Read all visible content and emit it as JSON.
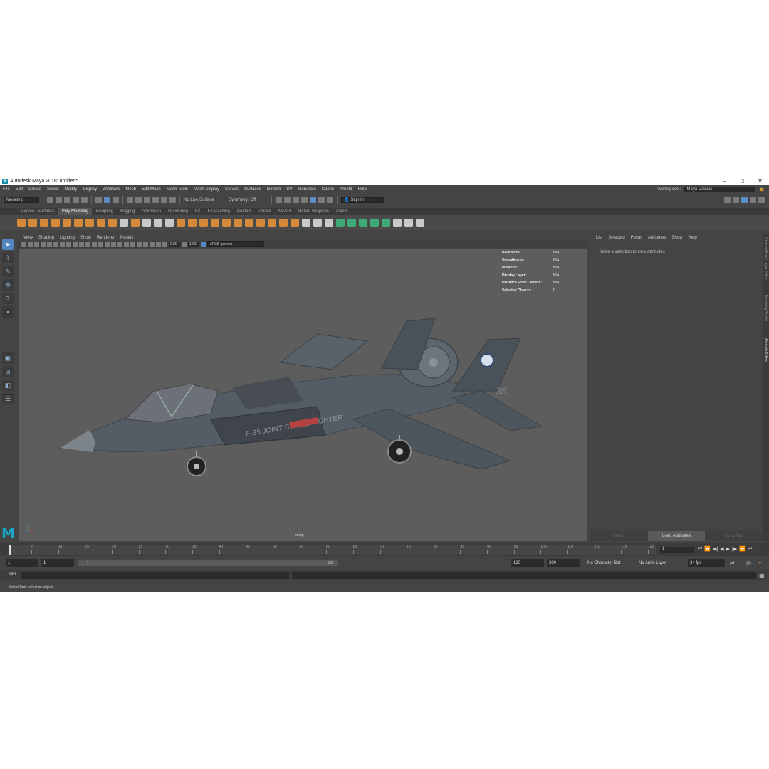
{
  "window": {
    "title": "Autodesk Maya 2018: untitled*",
    "logo": "M",
    "minimize": "–",
    "maximize": "□",
    "close": "✕"
  },
  "menubar": {
    "items": [
      "File",
      "Edit",
      "Create",
      "Select",
      "Modify",
      "Display",
      "Windows",
      "Mesh",
      "Edit Mesh",
      "Mesh Tools",
      "Mesh Display",
      "Curves",
      "Surfaces",
      "Deform",
      "UV",
      "Generate",
      "Cache",
      "Arnold",
      "Help"
    ],
    "workspace_label": "Workspace :",
    "workspace_value": "Maya Classic"
  },
  "statusline": {
    "mode": "Modeling",
    "live_surface": "No Live Surface",
    "symmetry": "Symmetry: Off",
    "sign_in": "Sign In"
  },
  "shelf": {
    "tabs": [
      "Curves / Surfaces",
      "Poly Modeling",
      "Sculpting",
      "Rigging",
      "Animation",
      "Rendering",
      "FX",
      "FX Caching",
      "Custom",
      "Arnold",
      "MASH",
      "Motion Graphics",
      "XGen"
    ],
    "active_tab": "Poly Modeling"
  },
  "viewport": {
    "menu": [
      "View",
      "Shading",
      "Lighting",
      "Show",
      "Renderer",
      "Panels"
    ],
    "exposure": "0.00",
    "gamma": "1.00",
    "color_space": "sRGB gamma",
    "camera": "persp",
    "hud": [
      {
        "key": "Backfaces:",
        "value": "N/A"
      },
      {
        "key": "Smoothness:",
        "value": "N/A"
      },
      {
        "key": "Instance:",
        "value": "N/A"
      },
      {
        "key": "Display Layer:",
        "value": "N/A"
      },
      {
        "key": "Distance From Camera:",
        "value": "N/A"
      },
      {
        "key": "Selected Objects:",
        "value": "0"
      }
    ],
    "livery_text": "F-35 JOINT STRIKE FIGHTER",
    "tail_number": "35"
  },
  "attribute_editor": {
    "menu": [
      "List",
      "Selected",
      "Focus",
      "Attributes",
      "Show",
      "Help"
    ],
    "message": "Make a selection to view attributes",
    "buttons": [
      "Select",
      "Load Attributes",
      "Copy Tab"
    ],
    "side_tabs": [
      "Channel Box / Layer Editor",
      "Modeling Toolkit",
      "Attribute Editor"
    ]
  },
  "timeline": {
    "ticks": [
      "1",
      "5",
      "10",
      "15",
      "20",
      "25",
      "30",
      "35",
      "40",
      "45",
      "50",
      "55",
      "60",
      "65",
      "70",
      "75",
      "80",
      "85",
      "90",
      "95",
      "100",
      "105",
      "110",
      "115",
      "120"
    ],
    "current_frame": "1"
  },
  "range": {
    "start": "1",
    "playback_start": "1",
    "slider_start": "1",
    "slider_end": "120",
    "playback_end": "120",
    "end": "200",
    "character_set": "No Character Set",
    "anim_layer": "No Anim Layer",
    "fps": "24 fps"
  },
  "command_line": {
    "label": "MEL"
  },
  "help_line": {
    "text": "Select Tool: select an object"
  }
}
